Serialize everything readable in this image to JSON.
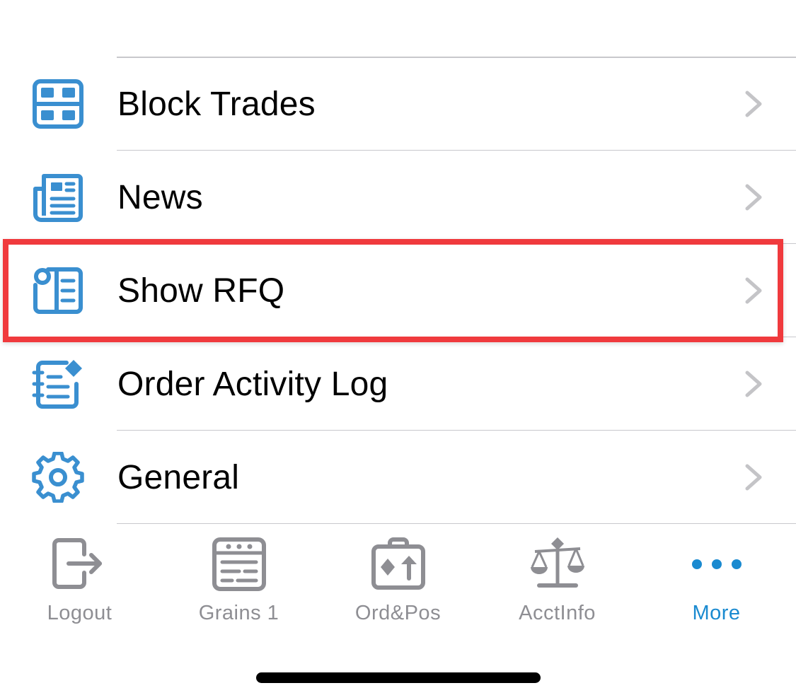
{
  "menu": {
    "items": [
      {
        "label": "Block Trades",
        "icon": "block-trades-icon"
      },
      {
        "label": "News",
        "icon": "news-icon"
      },
      {
        "label": "Show RFQ",
        "icon": "show-rfq-icon"
      },
      {
        "label": "Order Activity Log",
        "icon": "order-activity-log-icon"
      },
      {
        "label": "General",
        "icon": "gear-icon"
      }
    ],
    "highlighted_item": "Show RFQ"
  },
  "tab_bar": {
    "tabs": [
      {
        "label": "Logout",
        "icon": "logout-icon",
        "active": false
      },
      {
        "label": "Grains 1",
        "icon": "grains-grid-icon",
        "active": false
      },
      {
        "label": "Ord&Pos",
        "icon": "briefcase-icon",
        "active": false
      },
      {
        "label": "AcctInfo",
        "icon": "scales-icon",
        "active": false
      },
      {
        "label": "More",
        "icon": "more-dots-icon",
        "active": true
      }
    ]
  },
  "colors": {
    "icon_blue": "#3a8fd0",
    "active_tab": "#1a8ad0",
    "inactive_tab": "#8e8e93",
    "highlight_border": "#f03a3d",
    "chevron": "#c4c4c7",
    "divider": "#c8c8cc"
  }
}
